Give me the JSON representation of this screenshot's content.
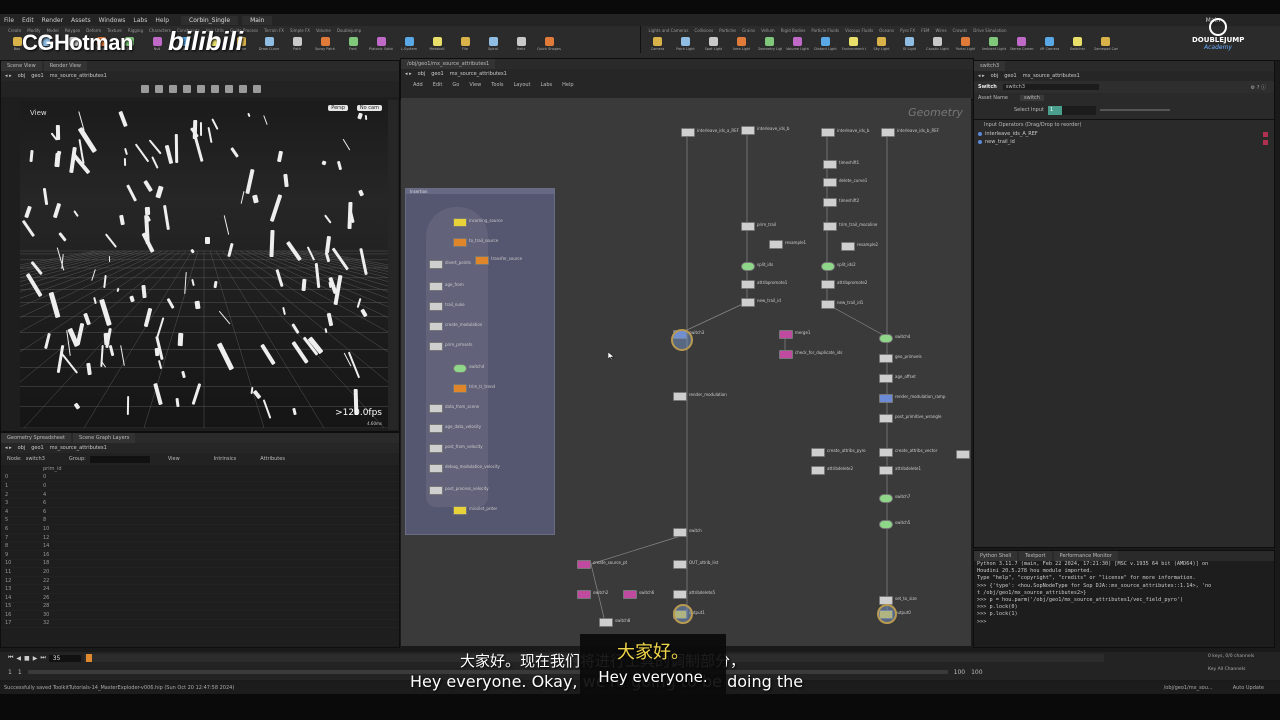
{
  "menubar": {
    "items": [
      "File",
      "Edit",
      "Render",
      "Assets",
      "Windows",
      "Labs",
      "Help"
    ],
    "desktops": [
      "Corbin_Single",
      "Main"
    ],
    "right": "Main"
  },
  "shelf": {
    "tabs": [
      "Create",
      "Modify",
      "Model",
      "Polygon",
      "Deform",
      "Texture",
      "Rigging",
      "Characters",
      "Constraints",
      "Hair Utils",
      "Guide Process",
      "Terrain FX",
      "Simple FX",
      "Volume",
      "Doublejump"
    ],
    "tools": [
      "Box",
      "Sphere",
      "Tube",
      "Torus",
      "Grid",
      "Null",
      "Line",
      "Circle",
      "Curve",
      "Draw Curve",
      "Path",
      "Spray Paint",
      "Font",
      "Platonic Solids",
      "L-System",
      "Metaball",
      "File",
      "Spiral",
      "Helix",
      "Quick Shapes"
    ],
    "lights_tabs": [
      "Lights and Cameras",
      "Collisions",
      "Particles",
      "Grains",
      "Vellum",
      "Rigid Bodies",
      "Particle Fluids",
      "Viscous Fluids",
      "Oceans",
      "Pyro FX",
      "FEM",
      "Wires",
      "Crowds",
      "Drive Simulation"
    ],
    "lights_tools": [
      "Camera",
      "Point Light",
      "Spot Light",
      "Area Light",
      "Geometry Light",
      "Volume Light",
      "Distant Light",
      "Environment Light",
      "Sky Light",
      "GI Light",
      "Caustic Light",
      "Portal Light",
      "Ambient Light",
      "Stereo Camera",
      "VR Camera",
      "Switcher",
      "Gamepad Camera"
    ]
  },
  "watermark": {
    "left": "CGHotman",
    "left2": "bilibili",
    "brand": "DOUBLEJUMP",
    "brand_sub": "Academy"
  },
  "viewport_pane": {
    "tabs": [
      "Scene View",
      "Render View"
    ],
    "path": [
      "obj",
      "geo1"
    ],
    "node_path": "mx_source_attributes1",
    "view_label": "View",
    "persp": "Persp",
    "cam": "No cam",
    "fps": ">120.0fps",
    "time": "4.60ms"
  },
  "spreadsheet": {
    "tabs": [
      "Geometry Spreadsheet",
      "Scene Graph Layers"
    ],
    "path": [
      "obj",
      "geo1"
    ],
    "node_path": "mx_source_attributes1",
    "node_label": "Node:",
    "node_name": "switch3",
    "group_label": "Group:",
    "view_label": "View",
    "intrinsics_label": "Intrinsics",
    "attributes_label": "Attributes",
    "column": "prim_id",
    "rows": [
      {
        "i": "0",
        "v": "0"
      },
      {
        "i": "1",
        "v": "0"
      },
      {
        "i": "2",
        "v": "4"
      },
      {
        "i": "3",
        "v": "6"
      },
      {
        "i": "4",
        "v": "6"
      },
      {
        "i": "5",
        "v": "8"
      },
      {
        "i": "6",
        "v": "10"
      },
      {
        "i": "7",
        "v": "12"
      },
      {
        "i": "8",
        "v": "14"
      },
      {
        "i": "9",
        "v": "16"
      },
      {
        "i": "10",
        "v": "18"
      },
      {
        "i": "11",
        "v": "20"
      },
      {
        "i": "12",
        "v": "22"
      },
      {
        "i": "13",
        "v": "24"
      },
      {
        "i": "14",
        "v": "26"
      },
      {
        "i": "15",
        "v": "28"
      },
      {
        "i": "16",
        "v": "30"
      },
      {
        "i": "17",
        "v": "32"
      }
    ]
  },
  "network": {
    "tab": "/obj/geo1/mx_source_attributes1",
    "path": [
      "obj",
      "geo1"
    ],
    "node_path": "mx_source_attributes1",
    "menu": [
      "Add",
      "Edit",
      "Go",
      "View",
      "Tools",
      "Layout",
      "Labs",
      "Help"
    ],
    "context_label": "Geometry",
    "box_label": "Insertion",
    "nodes": [
      {
        "name": "interleave_ids_a_REF"
      },
      {
        "name": "interleave_ids_b"
      },
      {
        "name": "interleave_ids_b"
      },
      {
        "name": "interleave_ids_b_REF"
      },
      {
        "name": "timeshift1"
      },
      {
        "name": "delete_curve1"
      },
      {
        "name": "timeshift2"
      },
      {
        "name": "prim_trail"
      },
      {
        "name": "trim_trail_mocoline"
      },
      {
        "name": "resample1"
      },
      {
        "name": "resample2"
      },
      {
        "name": "split_ids"
      },
      {
        "name": "split_ids2"
      },
      {
        "name": "attribpromote1"
      },
      {
        "name": "attribpromote2"
      },
      {
        "name": "new_trail_id"
      },
      {
        "name": "new_trail_id1"
      },
      {
        "name": "switch3"
      },
      {
        "name": "merge1"
      },
      {
        "name": "check_for_duplicate_ids"
      },
      {
        "name": "switch4"
      },
      {
        "name": "geo_primvels"
      },
      {
        "name": "age_offset"
      },
      {
        "name": "render_modulation"
      },
      {
        "name": "render_modulation_ramp"
      },
      {
        "name": "post_primitive_wrangle"
      },
      {
        "name": "create_attribs_pyro"
      },
      {
        "name": "create_attribs_vector"
      },
      {
        "name": "attribdelete2"
      },
      {
        "name": "attribdelete1"
      },
      {
        "name": "switch7"
      },
      {
        "name": "switch5"
      },
      {
        "name": "switch"
      },
      {
        "name": "rundsc"
      },
      {
        "name": "create_source_pt"
      },
      {
        "name": "OUT_attrib_list"
      },
      {
        "name": "attribdelete5"
      },
      {
        "name": "switch2"
      },
      {
        "name": "switch6"
      },
      {
        "name": "switch8"
      },
      {
        "name": "output1"
      },
      {
        "name": "output0"
      },
      {
        "name": "set_to_size"
      }
    ],
    "box_nodes": [
      {
        "name": "incoming_source"
      },
      {
        "name": "to_trail_source"
      },
      {
        "name": "transfer_source"
      },
      {
        "name": "divert_points"
      },
      {
        "name": "age_from"
      },
      {
        "name": "trail_nuke"
      },
      {
        "name": "create_modulation"
      },
      {
        "name": "prim_prmsets"
      },
      {
        "name": "switch4"
      },
      {
        "name": "trim_tr_trend"
      },
      {
        "name": "data_from_scene"
      },
      {
        "name": "age_data_velocity"
      },
      {
        "name": "post_from_velocity"
      },
      {
        "name": "debug_modulation_velocity"
      },
      {
        "name": "post_process_velocity"
      },
      {
        "name": "missilet_pnter"
      }
    ]
  },
  "parameters": {
    "tab": "switch3",
    "path": [
      "obj",
      "geo1"
    ],
    "node_path": "mx_source_attributes1",
    "node_type": "Switch",
    "node_name": "switch3",
    "asset_name": "Asset Name",
    "asset_value": "switch",
    "select_input_label": "Select Input",
    "select_input_value": "1",
    "select_input_fraction": 0.3,
    "inputs_header": "Input Operators (Drag/Drop to reorder)",
    "inputs": [
      "interleave_ids_A_REF",
      "new_trail_id"
    ]
  },
  "shell": {
    "tabs": [
      "Python Shell",
      "Textport",
      "Performance Monitor"
    ],
    "lines": [
      "Python 3.11.7 (main, Feb 22 2024, 17:21:30) [MSC v.1935 64 bit (AMD64)] on",
      "Houdini 20.5.278 hou module imported.",
      "Type \"help\", \"copyright\", \"credits\" or \"license\" for more information.",
      ">>> {'type': <hou.SopNodeType for Sop DJA::mx_source_attributes::1.14>, 'no",
      "t /obj/geo1/mx_source_attributes2>}",
      ">>> p = hou.parm('/obj/geo1/mx_source_attributes1/vec_field_pyro')",
      ">>> p.lock(0)",
      ">>> p.lock(1)",
      ">>>"
    ]
  },
  "timeline": {
    "frame": "35",
    "start": "1",
    "start2": "1",
    "end": "100",
    "end2": "100",
    "keys": "0 keys, 0/0 channels",
    "keyall": "Key All Channels"
  },
  "status": {
    "message": "Successfully saved ToolkitTutorials-14_MasterExploder-v006.hip (Sun Oct 20 12:47:58 2024)",
    "path": "/obj/geo1/mx_sou...",
    "autoupdate": "Auto Update"
  },
  "subtitles": {
    "cn_big": "大家好。",
    "cn_line": "大家好。现在我们将进行工具的调制部分，",
    "en_big": "Hey everyone.",
    "en_line": "Hey everyone. Okay, we're going to be doing the"
  }
}
